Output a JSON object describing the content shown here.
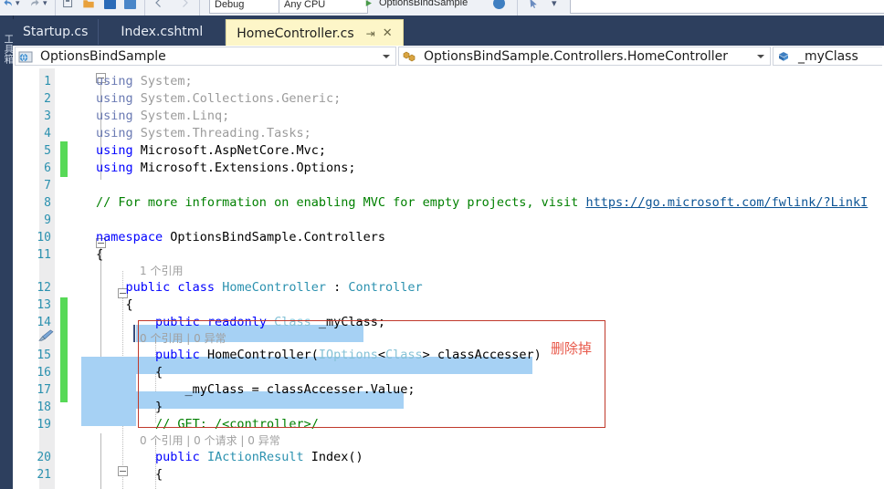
{
  "toolbar": {
    "configuration": "Debug",
    "platform": "Any CPU",
    "startup_project": "OptionsBindSample",
    "icons": [
      "undo-icon",
      "redo-icon",
      "save-all-icon",
      "open-folder-icon",
      "window-icon",
      "panel-icon",
      "nav-back-icon",
      "nav-forward-icon",
      "run-icon",
      "dropdown-icon"
    ]
  },
  "toolbox": {
    "label": "工具箱"
  },
  "tabs": [
    {
      "label": "Startup.cs",
      "active": false
    },
    {
      "label": "Index.cshtml",
      "active": false
    },
    {
      "label": "HomeController.cs",
      "active": true,
      "pin": "⇥",
      "close": "✕"
    }
  ],
  "navbar": {
    "project": "OptionsBindSample",
    "project_icon": "web-project-icon",
    "type": "OptionsBindSample.Controllers.HomeController",
    "type_icon": "class-icon",
    "member": "_myClass",
    "member_icon": "field-icon",
    "dropdown_icon": "chevron-down-icon"
  },
  "annotation": {
    "text": "删除掉",
    "color": "#e8594a"
  },
  "editor": {
    "lines": [
      {
        "n": "1",
        "codelens": null,
        "segments": [
          {
            "t": "using ",
            "c": "kw-dim"
          },
          {
            "t": "System;",
            "c": "txt-dim"
          }
        ]
      },
      {
        "n": "2",
        "codelens": null,
        "segments": [
          {
            "t": "using ",
            "c": "kw-dim"
          },
          {
            "t": "System.Collections.Generic;",
            "c": "txt-dim"
          }
        ]
      },
      {
        "n": "3",
        "codelens": null,
        "segments": [
          {
            "t": "using ",
            "c": "kw-dim"
          },
          {
            "t": "System.Linq;",
            "c": "txt-dim"
          }
        ]
      },
      {
        "n": "4",
        "codelens": null,
        "segments": [
          {
            "t": "using ",
            "c": "kw-dim"
          },
          {
            "t": "System.Threading.Tasks;",
            "c": "txt-dim"
          }
        ]
      },
      {
        "n": "5",
        "codelens": null,
        "segments": [
          {
            "t": "using ",
            "c": "kw"
          },
          {
            "t": "Microsoft.AspNetCore.Mvc;",
            "c": "txt"
          }
        ]
      },
      {
        "n": "6",
        "codelens": null,
        "segments": [
          {
            "t": "using ",
            "c": "kw"
          },
          {
            "t": "Microsoft.Extensions.Options;",
            "c": "txt"
          }
        ]
      },
      {
        "n": "7",
        "codelens": null,
        "segments": []
      },
      {
        "n": "8",
        "codelens": null,
        "segments": [
          {
            "t": "// For more information on enabling MVC for empty projects, visit ",
            "c": "cmt"
          },
          {
            "t": "https://go.microsoft.com/fwlink/?LinkI",
            "c": "lnk"
          }
        ]
      },
      {
        "n": "9",
        "codelens": null,
        "segments": []
      },
      {
        "n": "10",
        "codelens": null,
        "segments": [
          {
            "t": "namespace ",
            "c": "kw"
          },
          {
            "t": "OptionsBindSample.Controllers",
            "c": "txt"
          }
        ]
      },
      {
        "n": "11",
        "codelens": null,
        "segments": [
          {
            "t": "{",
            "c": "txt"
          }
        ]
      },
      {
        "n": "12",
        "codelens": "1 个引用",
        "segments": [
          {
            "t": "    ",
            "c": "txt"
          },
          {
            "t": "public class ",
            "c": "kw"
          },
          {
            "t": "HomeController",
            "c": "typ"
          },
          {
            "t": " : ",
            "c": "txt"
          },
          {
            "t": "Controller",
            "c": "typ"
          }
        ]
      },
      {
        "n": "13",
        "codelens": null,
        "segments": [
          {
            "t": "    {",
            "c": "txt"
          }
        ]
      },
      {
        "n": "14",
        "codelens": null,
        "segments": [
          {
            "t": "        ",
            "c": "txt"
          },
          {
            "t": "public readonly ",
            "c": "kw"
          },
          {
            "t": "Class",
            "c": "typ-dim"
          },
          {
            "t": " _myClass;",
            "c": "txt"
          }
        ]
      },
      {
        "n": "15",
        "codelens": "0 个引用 | 0 异常",
        "segments": [
          {
            "t": "        ",
            "c": "txt"
          },
          {
            "t": "public ",
            "c": "kw"
          },
          {
            "t": "HomeController(",
            "c": "txt"
          },
          {
            "t": "IOptions",
            "c": "typ-dim"
          },
          {
            "t": "<",
            "c": "txt"
          },
          {
            "t": "Class",
            "c": "typ-dim"
          },
          {
            "t": "> classAccesser)",
            "c": "txt"
          }
        ]
      },
      {
        "n": "16",
        "codelens": null,
        "segments": [
          {
            "t": "        {",
            "c": "txt"
          }
        ]
      },
      {
        "n": "17",
        "codelens": null,
        "segments": [
          {
            "t": "            _myClass = classAccesser.Value;",
            "c": "txt"
          }
        ]
      },
      {
        "n": "18",
        "codelens": null,
        "segments": [
          {
            "t": "        }",
            "c": "txt"
          }
        ]
      },
      {
        "n": "19",
        "codelens": null,
        "segments": [
          {
            "t": "        ",
            "c": "txt"
          },
          {
            "t": "// GET: /<controller>/",
            "c": "cmt"
          }
        ]
      },
      {
        "n": "20",
        "codelens": "0 个引用 | 0 个请求 | 0 异常",
        "segments": [
          {
            "t": "        ",
            "c": "txt"
          },
          {
            "t": "public ",
            "c": "kw"
          },
          {
            "t": "IActionResult",
            "c": "typ"
          },
          {
            "t": " Index()",
            "c": "txt"
          }
        ]
      },
      {
        "n": "21",
        "codelens": null,
        "segments": [
          {
            "t": "        {",
            "c": "txt"
          }
        ]
      }
    ]
  }
}
